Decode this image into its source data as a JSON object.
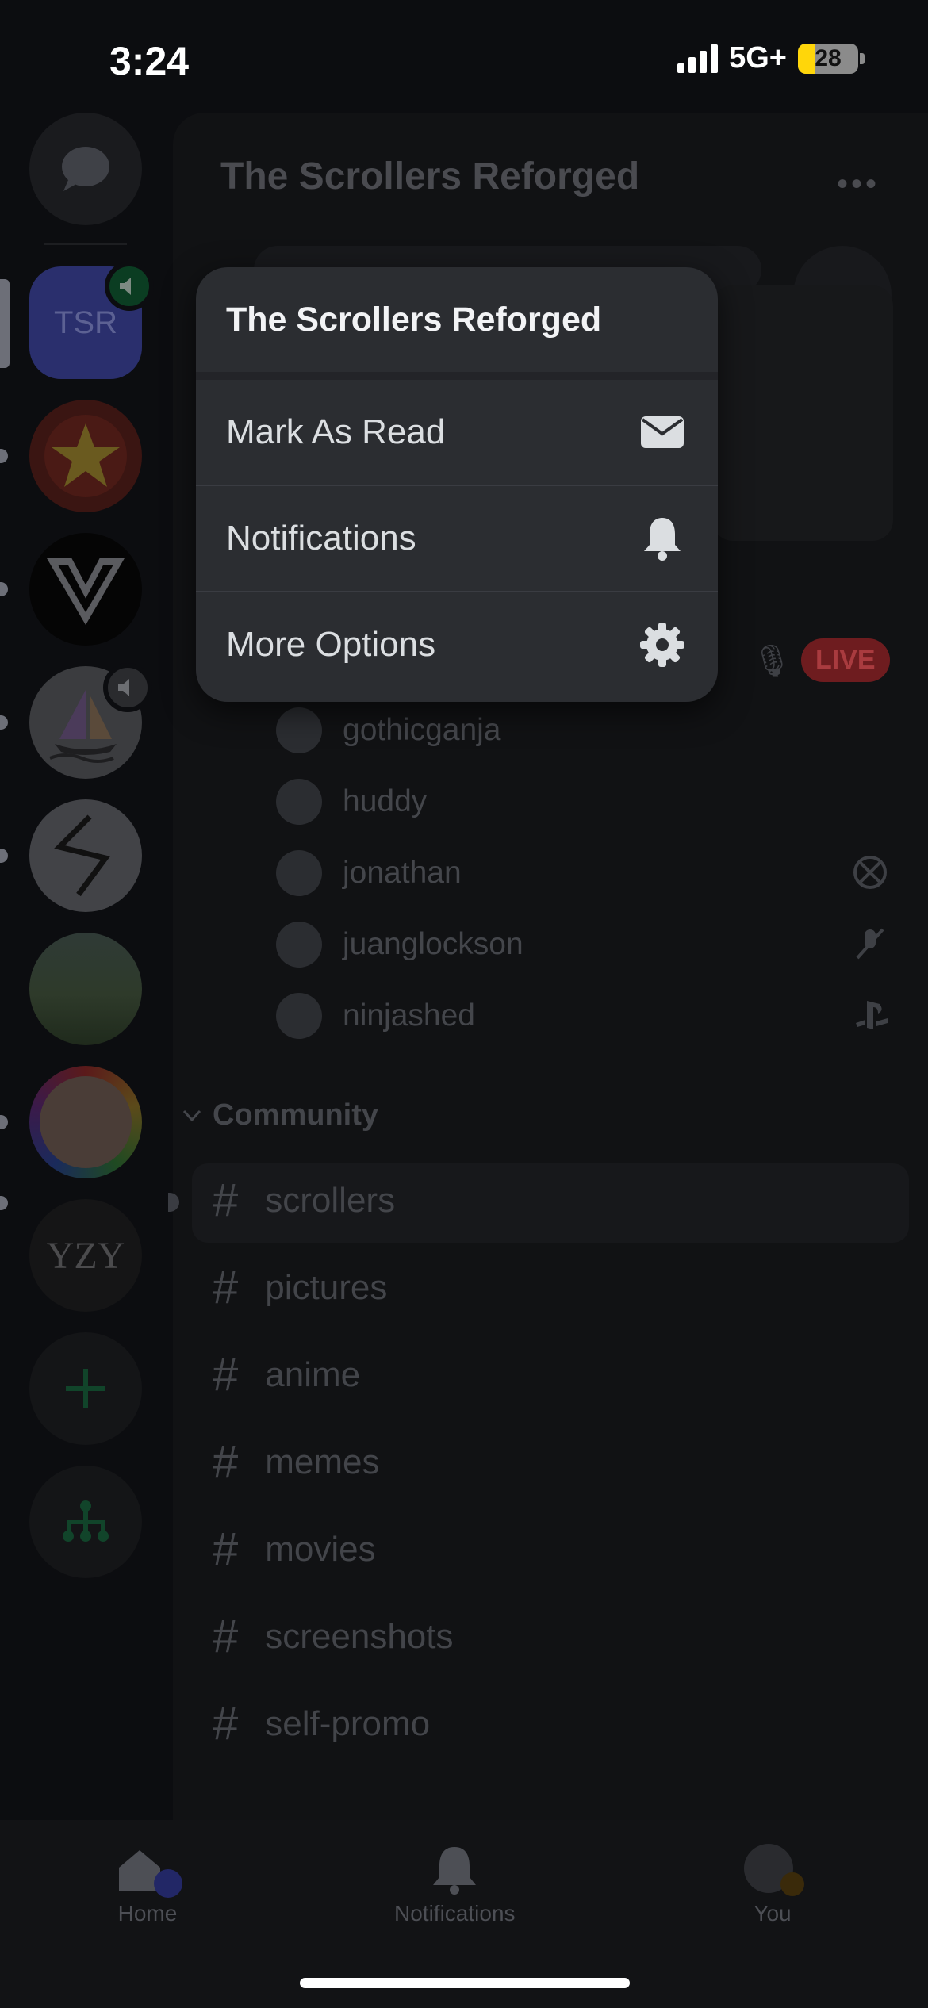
{
  "status": {
    "time": "3:24",
    "network": "5G+",
    "battery": "28",
    "battery_level": 0.28
  },
  "server": {
    "name": "The Scrollers Reforged",
    "rail": [
      {
        "label": "TSR"
      },
      {
        "label": "YZY"
      }
    ],
    "live_badge": "LIVE",
    "voice_users": [
      "gothicganja",
      "huddy",
      "jonathan",
      "juanglockson",
      "ninjashed"
    ],
    "category": "Community",
    "channels": [
      "scrollers",
      "pictures",
      "anime",
      "memes",
      "movies",
      "screenshots",
      "self-promo"
    ],
    "hash": "#"
  },
  "popup": {
    "title": "The Scrollers Reforged",
    "items": [
      {
        "label": "Mark As Read",
        "icon": "envelope-icon"
      },
      {
        "label": "Notifications",
        "icon": "bell-icon"
      },
      {
        "label": "More Options",
        "icon": "gear-icon"
      }
    ]
  },
  "nav": {
    "home": "Home",
    "notifications": "Notifications",
    "you": "You"
  },
  "colors": {
    "accent": "#5865f2",
    "live": "#da373c",
    "popup_bg": "#2b2d31",
    "online": "#23a55a"
  }
}
